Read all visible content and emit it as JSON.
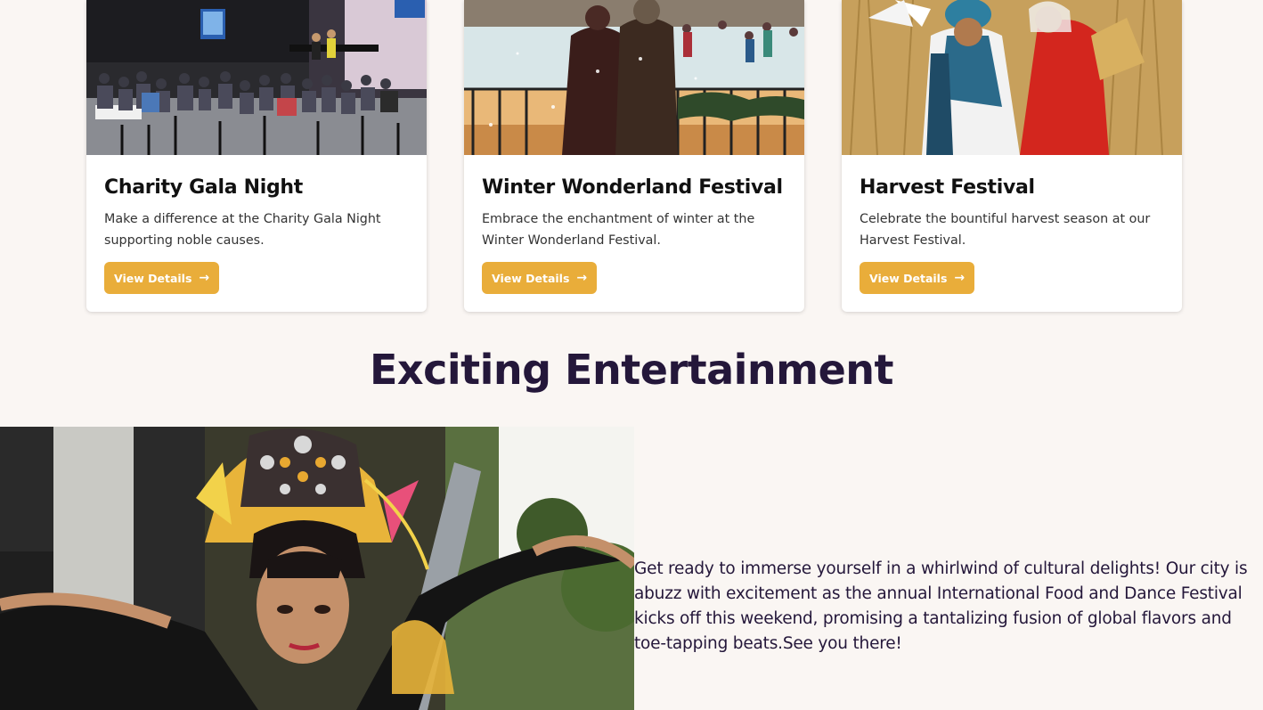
{
  "events": [
    {
      "title": "Charity Gala Night",
      "description": "Make a difference at the Charity Gala Night supporting noble causes.",
      "button_label": "View Details"
    },
    {
      "title": "Winter Wonderland Festival",
      "description": "Embrace the enchantment of winter at the Winter Wonderland Festival.",
      "button_label": "View Details"
    },
    {
      "title": "Harvest Festival",
      "description": "Celebrate the bountiful harvest season at our Harvest Festival.",
      "button_label": "View Details"
    }
  ],
  "entertainment": {
    "heading": "Exciting Entertainment",
    "body": "Get ready to immerse yourself in a whirlwind of cultural delights! Our city is abuzz with excitement as the annual International Food and Dance Festival kicks off this weekend, promising a tantalizing fusion of global flavors and toe-tapping beats.See you there!"
  },
  "icons": {
    "button_arrow": "arrow-right-icon"
  },
  "colors": {
    "page_background": "#faf6f3",
    "accent": "#e9ad3a",
    "heading": "#24173a"
  }
}
